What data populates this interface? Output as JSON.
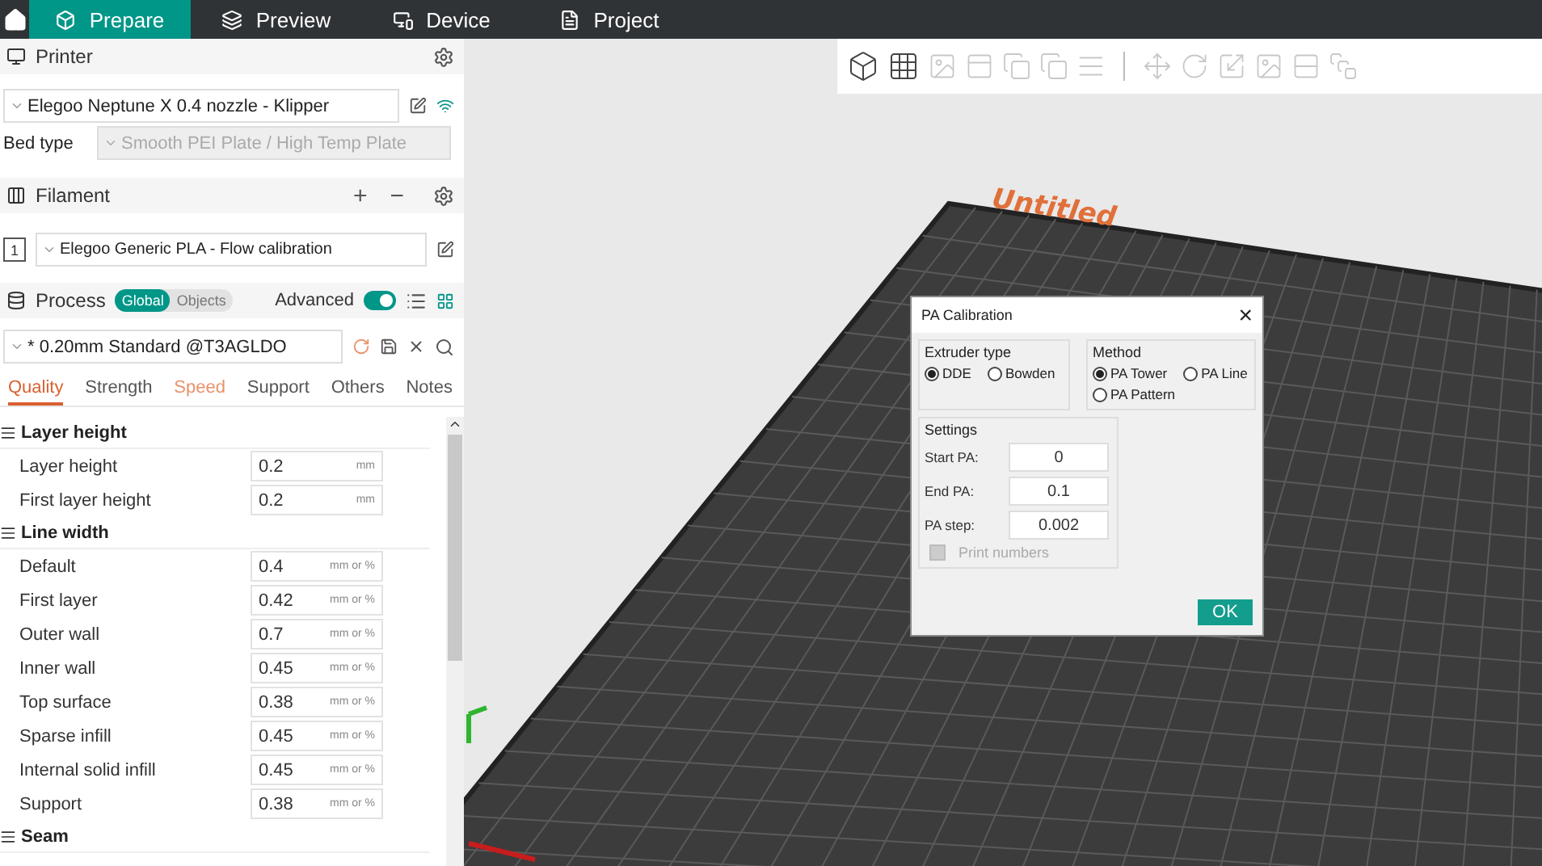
{
  "nav_tabs": [
    {
      "label": "Prepare",
      "selected": true
    },
    {
      "label": "Preview",
      "selected": false
    },
    {
      "label": "Device",
      "selected": false
    },
    {
      "label": "Project",
      "selected": false
    }
  ],
  "printer": {
    "title": "Printer",
    "preset": "Elegoo Neptune X 0.4 nozzle - Klipper",
    "bed_type_label": "Bed type",
    "bed_type": "Smooth PEI Plate / High Temp Plate"
  },
  "filament": {
    "title": "Filament",
    "plus": "+",
    "minus": "−",
    "slot": "1",
    "preset": "Elegoo Generic PLA - Flow calibration"
  },
  "process": {
    "title": "Process",
    "scope": [
      {
        "label": "Global",
        "selected": true
      },
      {
        "label": "Objects",
        "selected": false
      }
    ],
    "advanced_label": "Advanced",
    "advanced_on": true,
    "preset": "* 0.20mm Standard @T3AGLDO",
    "tabs": [
      {
        "label": "Quality",
        "selected": true,
        "modified": true
      },
      {
        "label": "Strength",
        "selected": false,
        "modified": false
      },
      {
        "label": "Speed",
        "selected": false,
        "modified": true
      },
      {
        "label": "Support",
        "selected": false,
        "modified": false
      },
      {
        "label": "Others",
        "selected": false,
        "modified": false
      },
      {
        "label": "Notes",
        "selected": false,
        "modified": false
      }
    ],
    "groups": [
      {
        "title": "Layer height",
        "rows": [
          {
            "label": "Layer height",
            "value": "0.2",
            "unit": "mm"
          },
          {
            "label": "First layer height",
            "value": "0.2",
            "unit": "mm"
          }
        ]
      },
      {
        "title": "Line width",
        "rows": [
          {
            "label": "Default",
            "value": "0.4",
            "unit": "mm or %"
          },
          {
            "label": "First layer",
            "value": "0.42",
            "unit": "mm or %"
          },
          {
            "label": "Outer wall",
            "value": "0.7",
            "unit": "mm or %"
          },
          {
            "label": "Inner wall",
            "value": "0.45",
            "unit": "mm or %"
          },
          {
            "label": "Top surface",
            "value": "0.38",
            "unit": "mm or %"
          },
          {
            "label": "Sparse infill",
            "value": "0.45",
            "unit": "mm or %"
          },
          {
            "label": "Internal solid infill",
            "value": "0.45",
            "unit": "mm or %"
          },
          {
            "label": "Support",
            "value": "0.38",
            "unit": "mm or %"
          }
        ]
      },
      {
        "title": "Seam"
      }
    ]
  },
  "toolbar": [
    {
      "disabled": false
    },
    {
      "disabled": false
    },
    {
      "disabled": true
    },
    {
      "disabled": true
    },
    {
      "disabled": true
    },
    {
      "disabled": true
    },
    {
      "disabled": true
    },
    {
      "disabled": true
    },
    {
      "disabled": true
    },
    {
      "disabled": true
    },
    {
      "disabled": true
    },
    {
      "disabled": true
    },
    {
      "disabled": true
    }
  ],
  "plate": {
    "label": "Untitled"
  },
  "dialog": {
    "title": "PA Calibration",
    "close": "×",
    "extruder_type": {
      "title": "Extruder type",
      "options": [
        {
          "label": "DDE",
          "selected": true
        },
        {
          "label": "Bowden",
          "selected": false
        }
      ]
    },
    "method": {
      "title": "Method",
      "options": [
        {
          "label": "PA Tower",
          "selected": true
        },
        {
          "label": "PA Line",
          "selected": false
        },
        {
          "label": "PA Pattern",
          "selected": false
        }
      ]
    },
    "settings": {
      "title": "Settings",
      "fields": [
        {
          "label": "Start PA:",
          "value": "0"
        },
        {
          "label": "End PA:",
          "value": "0.1"
        },
        {
          "label": "PA step:",
          "value": "0.002"
        }
      ],
      "print_numbers": {
        "label": "Print numbers",
        "checked": false,
        "disabled": true
      }
    },
    "ok": "OK"
  }
}
